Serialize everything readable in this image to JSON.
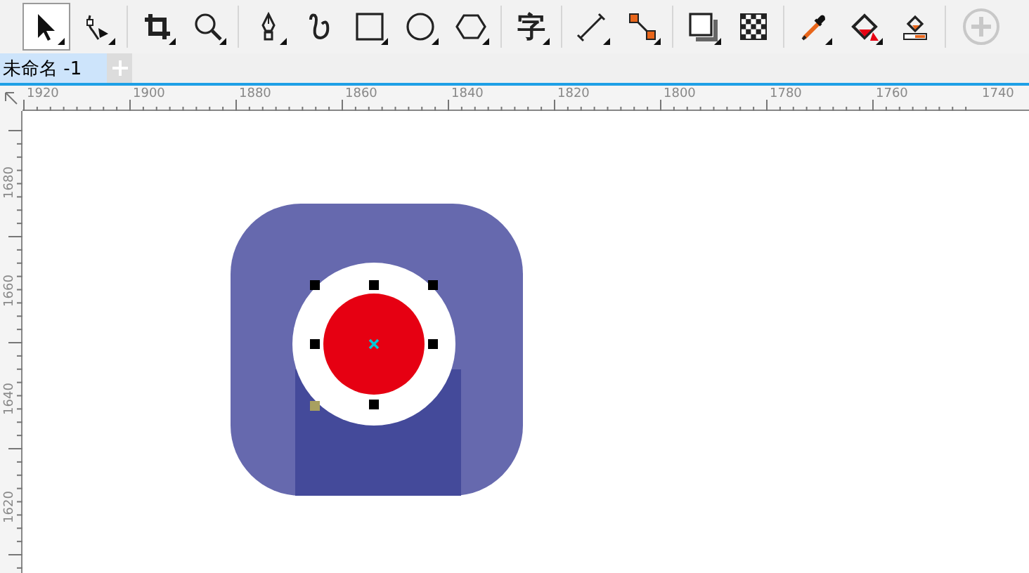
{
  "toolbar": {
    "groups": [
      [
        {
          "kind": "pick",
          "selected": true,
          "flyout": true
        },
        {
          "kind": "shape",
          "selected": false,
          "flyout": true
        }
      ],
      [
        {
          "kind": "crop",
          "selected": false,
          "flyout": true
        },
        {
          "kind": "zoom",
          "selected": false,
          "flyout": true
        }
      ],
      [
        {
          "kind": "pen",
          "selected": false,
          "flyout": true
        },
        {
          "kind": "curve",
          "selected": false,
          "flyout": false
        },
        {
          "kind": "rectangle",
          "selected": false,
          "flyout": true
        },
        {
          "kind": "ellipse",
          "selected": false,
          "flyout": true
        },
        {
          "kind": "polygon",
          "selected": false,
          "flyout": true
        }
      ],
      [
        {
          "kind": "text",
          "label": "字",
          "selected": false,
          "flyout": true
        }
      ],
      [
        {
          "kind": "dimension",
          "selected": false,
          "flyout": true
        },
        {
          "kind": "connector",
          "selected": false,
          "flyout": true
        }
      ],
      [
        {
          "kind": "shadow",
          "selected": false,
          "flyout": true
        },
        {
          "kind": "transparency",
          "selected": false,
          "flyout": false
        }
      ],
      [
        {
          "kind": "eyedropper",
          "selected": false,
          "flyout": true
        },
        {
          "kind": "fill",
          "selected": false,
          "flyout": true
        },
        {
          "kind": "interactive-fill",
          "selected": false,
          "flyout": false
        }
      ]
    ]
  },
  "tabs": [
    {
      "label": "未命名 -1",
      "selected": true
    }
  ],
  "rulers": {
    "horizontal": [
      "1920",
      "1900",
      "1880",
      "1860",
      "1840",
      "1820",
      "1800",
      "1780",
      "1760",
      "1740"
    ],
    "vertical": [
      "1680",
      "1660",
      "1640",
      "1620"
    ]
  }
}
